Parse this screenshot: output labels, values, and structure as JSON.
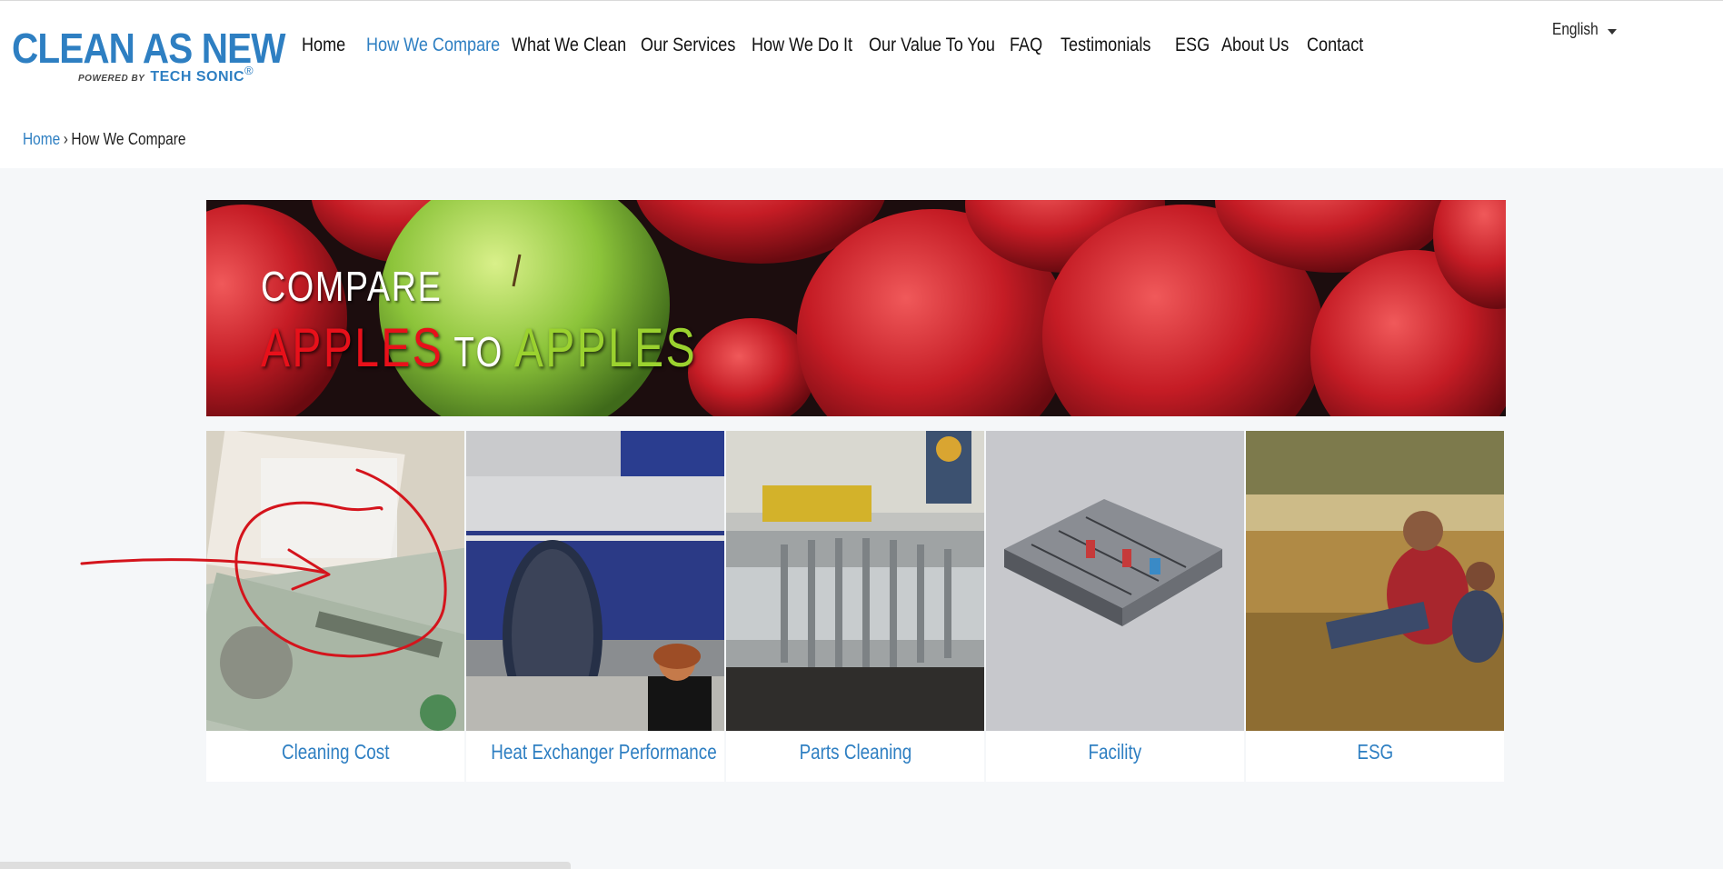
{
  "header": {
    "logo_main": "CLEAN AS NEW",
    "logo_powered_by": "POWERED BY",
    "logo_brand": "TECH SONIC",
    "logo_reg": "®",
    "nav": [
      {
        "label": "Home"
      },
      {
        "label": "How We Compare",
        "active": true
      },
      {
        "label": "What We Clean"
      },
      {
        "label": "Our Services"
      },
      {
        "label": "How We Do It"
      },
      {
        "label": "Our Value To You"
      },
      {
        "label": "FAQ"
      },
      {
        "label": "Testimonials"
      },
      {
        "label": "ESG"
      },
      {
        "label": "About Us"
      },
      {
        "label": "Contact"
      }
    ],
    "language": "English"
  },
  "breadcrumb": {
    "home": "Home",
    "separator": "›",
    "current": "How We Compare"
  },
  "hero": {
    "line1": "COMPARE",
    "word1": "APPLES",
    "word2": "TO",
    "word3": "APPLES"
  },
  "cards": [
    {
      "label": "Cleaning Cost"
    },
    {
      "label": "Heat Exchanger Performance"
    },
    {
      "label": "Parts Cleaning"
    },
    {
      "label": "Facility"
    },
    {
      "label": "ESG"
    }
  ],
  "colors": {
    "accent": "#2e7fc2",
    "apple_red": "#e8101a",
    "apple_green": "#9bd22f",
    "annotation": "#d4141c"
  }
}
